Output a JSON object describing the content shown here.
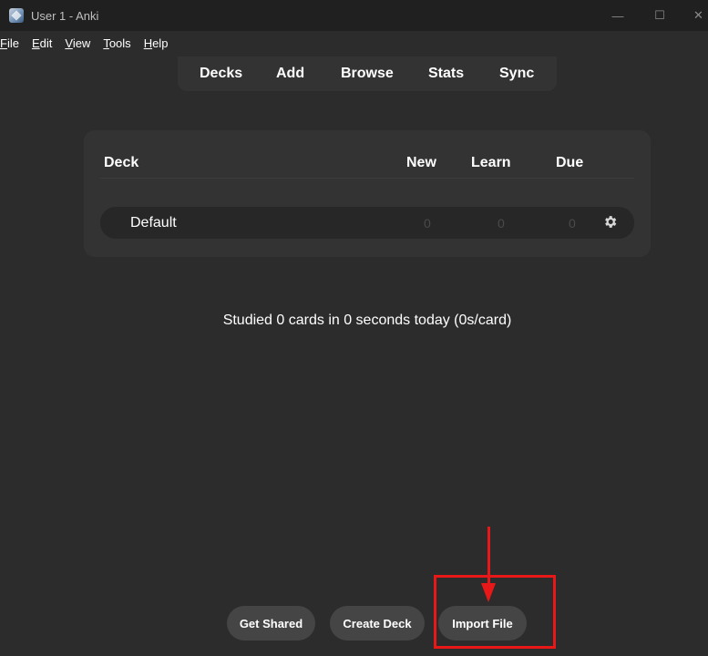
{
  "window": {
    "title": "User 1 - Anki",
    "controls": {
      "minimize": "—",
      "maximize": "☐",
      "close": "✕"
    }
  },
  "menu": {
    "items": [
      {
        "underline": "F",
        "rest": "ile"
      },
      {
        "underline": "E",
        "rest": "dit"
      },
      {
        "underline": "V",
        "rest": "iew"
      },
      {
        "underline": "T",
        "rest": "ools"
      },
      {
        "underline": "H",
        "rest": "elp"
      }
    ]
  },
  "toolbar": {
    "decks": "Decks",
    "add": "Add",
    "browse": "Browse",
    "stats": "Stats",
    "sync": "Sync"
  },
  "deck_table": {
    "headers": {
      "deck": "Deck",
      "new": "New",
      "learn": "Learn",
      "due": "Due"
    },
    "rows": [
      {
        "name": "Default",
        "new": "0",
        "learn": "0",
        "due": "0"
      }
    ]
  },
  "studied_text": "Studied 0 cards in 0 seconds today (0s/card)",
  "buttons": {
    "get_shared": "Get Shared",
    "create_deck": "Create Deck",
    "import_file": "Import File"
  },
  "colors": {
    "background": "#2c2c2c",
    "titlebar": "#202020",
    "panel": "#333333",
    "row": "#272727",
    "button": "#454545",
    "annotation": "#e81818"
  },
  "icons": {
    "app": "anki-app-icon",
    "gear": "gear-icon"
  }
}
